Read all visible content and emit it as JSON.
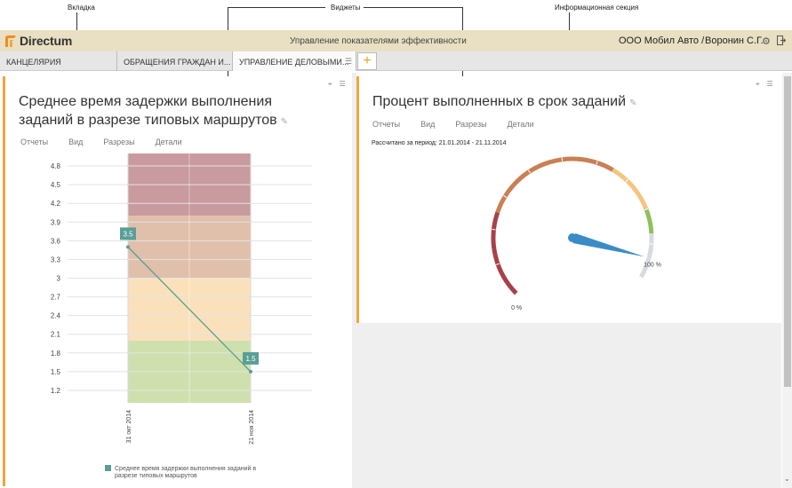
{
  "annotations": {
    "tab": "Вкладка",
    "widgets": "Виджеты",
    "info": "Информационная секция"
  },
  "header": {
    "logo_text": "Directum",
    "title": "Управление показателями эффективности",
    "org": "ООО Мобил Авто /",
    "user": "Воронин С.Г."
  },
  "tabs": [
    {
      "label": "КАНЦЕЛЯРИЯ"
    },
    {
      "label": "ОБРАЩЕНИЯ ГРАЖДАН И..."
    },
    {
      "label": "УПРАВЛЕНИЕ ДЕЛОВЫМИ..."
    }
  ],
  "tab_add": "+",
  "widget_menu": [
    "Отчеты",
    "Вид",
    "Разрезы",
    "Детали"
  ],
  "widget1": {
    "title": "Среднее время задержки выполнения заданий в разрезе типовых маршрутов"
  },
  "widget2": {
    "title": "Процент выполненных в срок заданий",
    "period": "Рассчитано за период: 21.01.2014 - 21.11.2014"
  },
  "chart_data": [
    {
      "type": "line",
      "x": [
        "31 окт 2014",
        "21 ноя 2014"
      ],
      "series": [
        {
          "name": "Среднее время задержки выполнения заданий в разрезе типовых маршрутов",
          "values": [
            3.5,
            1.5
          ],
          "color": "#5a9e96"
        }
      ],
      "y_ticks": [
        "4.8",
        "4.5",
        "4.2",
        "3.9",
        "3.6",
        "3.3",
        "3",
        "2.7",
        "2.4",
        "2.1",
        "1.8",
        "1.5",
        "1.2"
      ],
      "ylim": [
        1.0,
        5.0
      ],
      "bands": [
        {
          "from": 4.0,
          "to": 5.0,
          "color": "#c99a9e"
        },
        {
          "from": 3.0,
          "to": 4.0,
          "color": "#e0c0aa"
        },
        {
          "from": 2.0,
          "to": 3.0,
          "color": "#fbe1bb"
        },
        {
          "from": 1.0,
          "to": 2.0,
          "color": "#cfe0ae"
        }
      ],
      "data_labels": [
        "3.5",
        "1.5"
      ],
      "legend": "bottom",
      "grid": true
    },
    {
      "type": "gauge",
      "value_percent": 94,
      "min_label": "0 %",
      "max_label": "100 %",
      "segments": [
        {
          "from": 0,
          "to": 25,
          "color": "#a94048"
        },
        {
          "from": 25,
          "to": 65,
          "color": "#c98054"
        },
        {
          "from": 65,
          "to": 80,
          "color": "#f5c580"
        },
        {
          "from": 80,
          "to": 87,
          "color": "#8ec05b"
        },
        {
          "from": 87,
          "to": 100,
          "color": "#d8dae0"
        }
      ],
      "needle_color": "#3b8cc6"
    }
  ],
  "colors": {
    "accent": "#f0a53c",
    "header_bg": "#e9dfc2"
  }
}
